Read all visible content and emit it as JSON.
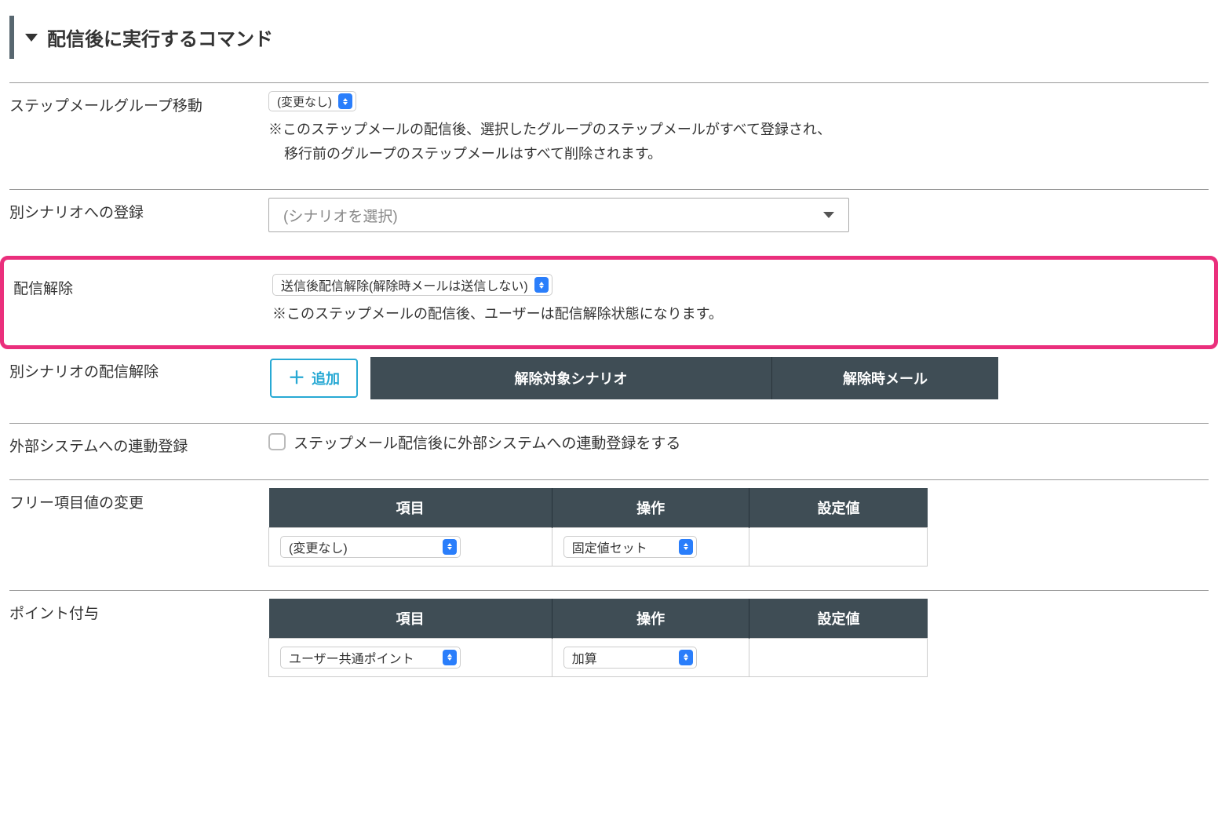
{
  "section": {
    "title": "配信後に実行するコマンド"
  },
  "groupMove": {
    "label": "ステップメールグループ移動",
    "selectValue": "(変更なし)",
    "note_line1": "※このステップメールの配信後、選択したグループのステップメールがすべて登録され、",
    "note_line2": "移行前のグループのステップメールはすべて削除されます。"
  },
  "altScenario": {
    "label": "別シナリオへの登録",
    "placeholder": "(シナリオを選択)"
  },
  "unsubscribe": {
    "label": "配信解除",
    "selectValue": "送信後配信解除(解除時メールは送信しない)",
    "note": "※このステップメールの配信後、ユーザーは配信解除状態になります。"
  },
  "altScenarioCancel": {
    "label": "別シナリオの配信解除",
    "addButton": "追加",
    "th1": "解除対象シナリオ",
    "th2": "解除時メール"
  },
  "externalLink": {
    "label": "外部システムへの連動登録",
    "checkboxLabel": "ステップメール配信後に外部システムへの連動登録をする"
  },
  "freeItem": {
    "label": "フリー項目値の変更",
    "th_item": "項目",
    "th_op": "操作",
    "th_val": "設定値",
    "itemValue": "(変更なし)",
    "opValue": "固定値セット",
    "setValue": ""
  },
  "pointGrant": {
    "label": "ポイント付与",
    "th_item": "項目",
    "th_op": "操作",
    "th_val": "設定値",
    "itemValue": "ユーザー共通ポイント",
    "opValue": "加算",
    "setValue": ""
  }
}
